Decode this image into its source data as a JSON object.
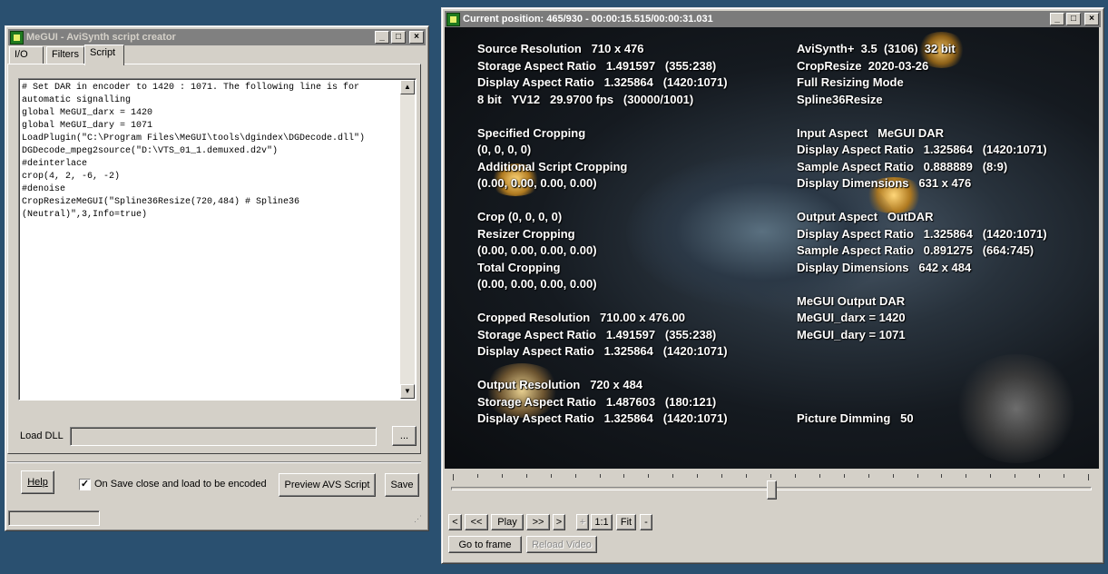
{
  "colors": {
    "desktop": "#2a5070",
    "window": "#d4d0c8",
    "titlebar": "#808080"
  },
  "creator": {
    "title": "MeGUI - AviSynth script creator",
    "tabs": [
      {
        "label": "I/O"
      },
      {
        "label": "Filters"
      },
      {
        "label": "Script"
      }
    ],
    "selected_tab": "Script",
    "script_lines": [
      "# Set DAR in encoder to 1420 : 1071. The following line is for automatic signalling",
      "global MeGUI_darx = 1420",
      "global MeGUI_dary = 1071",
      "LoadPlugin(\"C:\\Program Files\\MeGUI\\tools\\dgindex\\DGDecode.dll\")",
      "DGDecode_mpeg2source(\"D:\\VTS_01_1.demuxed.d2v\")",
      "#deinterlace",
      "crop(4, 2, -6, -2)",
      "#denoise",
      "CropResizeMeGUI(\"Spline36Resize(720,484) # Spline36 (Neutral)\",3,Info=true)"
    ],
    "load_dll_label": "Load DLL",
    "load_dll_value": "",
    "browse_label": "...",
    "help_label": "Help",
    "on_save_label": "On Save close and load to be encoded",
    "on_save_checked": true,
    "preview_label": "Preview AVS Script",
    "save_label": "Save"
  },
  "preview": {
    "title": "Current position: 465/930   -   00:00:15.515/00:00:31.031",
    "slider_position_fraction": 0.5,
    "left_lines": [
      "Source Resolution   710 x 476",
      "Storage Aspect Ratio   1.491597   (355:238)",
      "Display Aspect Ratio   1.325864   (1420:1071)",
      "8 bit   YV12   29.9700 fps   (30000/1001)",
      "",
      "Specified Cropping",
      "(0, 0, 0, 0)",
      "Additional Script Cropping",
      "(0.00, 0.00, 0.00, 0.00)",
      "",
      "Crop (0, 0, 0, 0)",
      "Resizer Cropping",
      "(0.00, 0.00, 0.00, 0.00)",
      "Total Cropping",
      "(0.00, 0.00, 0.00, 0.00)",
      "",
      "Cropped Resolution   710.00 x 476.00",
      "Storage Aspect Ratio   1.491597   (355:238)",
      "Display Aspect Ratio   1.325864   (1420:1071)",
      "",
      "Output Resolution   720 x 484",
      "Storage Aspect Ratio   1.487603   (180:121)",
      "Display Aspect Ratio   1.325864   (1420:1071)"
    ],
    "right_lines": [
      "AviSynth+  3.5  (3106)  32 bit",
      "CropResize  2020-03-26",
      "Full Resizing Mode",
      "Spline36Resize",
      "",
      "Input Aspect   MeGUI DAR",
      "Display Aspect Ratio   1.325864   (1420:1071)",
      "Sample Aspect Ratio   0.888889   (8:9)",
      "Display Dimensions   631 x 476",
      "",
      "Output Aspect   OutDAR",
      "Display Aspect Ratio   1.325864   (1420:1071)",
      "Sample Aspect Ratio   0.891275   (664:745)",
      "Display Dimensions   642 x 484",
      "",
      "MeGUI Output DAR",
      "MeGUI_darx = 1420",
      "MeGUI_dary = 1071",
      "",
      "",
      "",
      "",
      "Picture Dimming   50"
    ],
    "controls": [
      {
        "label": "<",
        "name": "prev-frame-button"
      },
      {
        "label": "<<",
        "name": "rewind-button"
      },
      {
        "label": "Play",
        "name": "play-button"
      },
      {
        "label": ">>",
        "name": "fast-forward-button"
      },
      {
        "label": ">",
        "name": "next-frame-button"
      },
      {
        "label": "+",
        "name": "zoom-in-button"
      },
      {
        "label": "1:1",
        "name": "zoom-1to1-button"
      },
      {
        "label": "Fit",
        "name": "zoom-fit-button"
      },
      {
        "label": "-",
        "name": "zoom-out-button"
      }
    ],
    "goto_label": "Go to frame",
    "reload_label": "Reload Video"
  }
}
